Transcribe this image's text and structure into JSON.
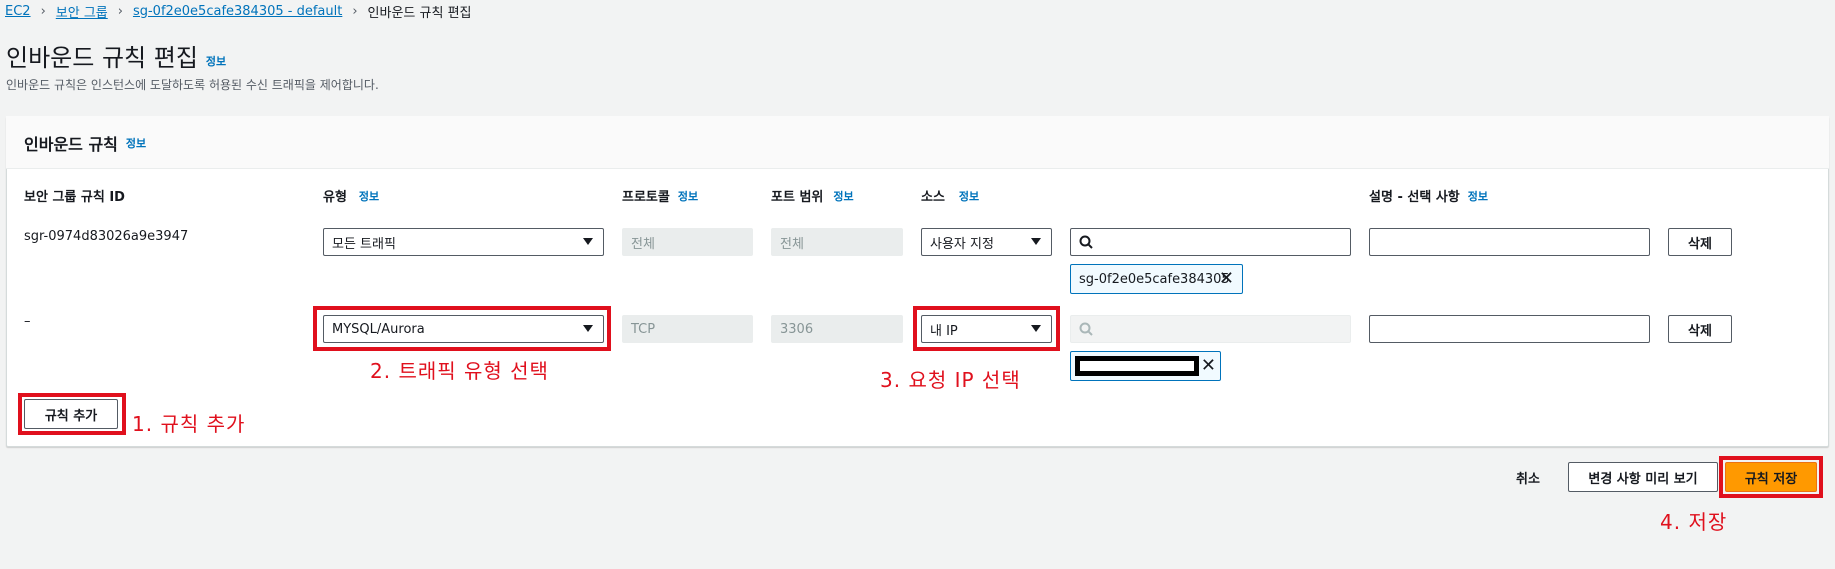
{
  "breadcrumb": {
    "items": [
      "EC2",
      "보안 그룹",
      "sg-0f2e0e5cafe384305 - default"
    ],
    "current": "인바운드 규칙 편집"
  },
  "page": {
    "title": "인바운드 규칙 편집",
    "title_info": "정보",
    "description": "인바운드 규칙은 인스턴스에 도달하도록 허용된 수신 트래픽을 제어합니다."
  },
  "panel": {
    "title": "인바운드 규칙",
    "title_info": "정보",
    "columns": {
      "rule_id": "보안 그룹 규칙 ID",
      "type": "유형",
      "type_info": "정보",
      "protocol": "프로토콜",
      "protocol_info": "정보",
      "port": "포트 범위",
      "port_info": "정보",
      "source": "소스",
      "source_info": "정보",
      "desc": "설명 - 선택 사항",
      "desc_info": "정보"
    },
    "rows": [
      {
        "rule_id": "sgr-0974d83026a9e3947",
        "type": "모든 트래픽",
        "protocol": "전체",
        "port": "전체",
        "source": "사용자 지정",
        "token": "sg-0f2e0e5cafe384305",
        "delete": "삭제"
      },
      {
        "rule_id": "–",
        "type": "MYSQL/Aurora",
        "protocol": "TCP",
        "port": "3306",
        "source": "내 IP",
        "delete": "삭제"
      }
    ],
    "add_rule": "규칙 추가"
  },
  "footer": {
    "cancel": "취소",
    "preview": "변경 사항 미리 보기",
    "save": "규칙 저장"
  },
  "annotations": {
    "a1": "1. 규칙 추가",
    "a2": "2. 트래픽 유형 선택",
    "a3": "3. 요청 IP 선택",
    "a4": "4. 저장"
  },
  "colors": {
    "accent": "#ff9900",
    "link": "#0073bb",
    "annotation": "#e0101d"
  }
}
